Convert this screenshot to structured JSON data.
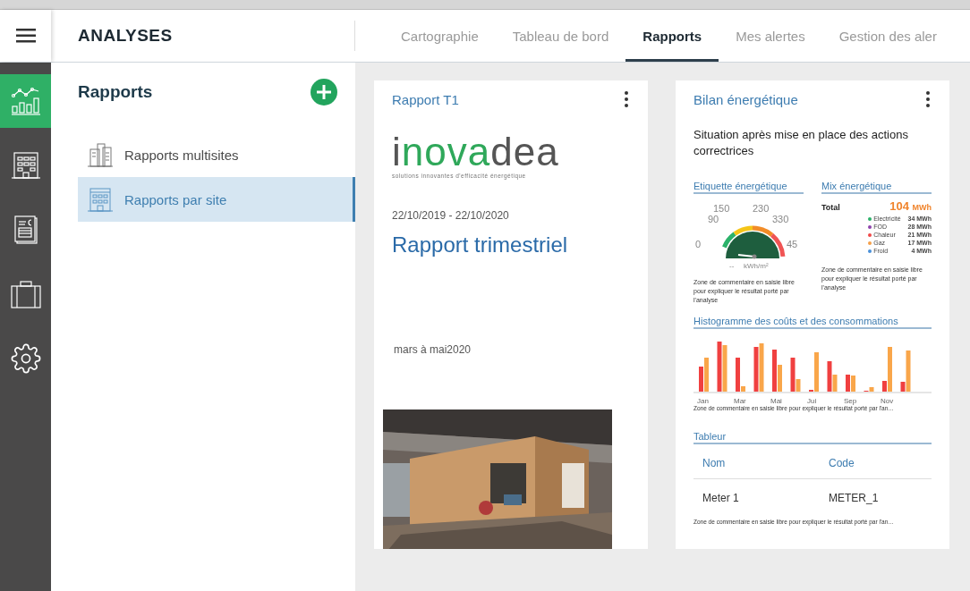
{
  "rail": {
    "items": [
      {
        "selected": true
      },
      {
        "selected": false
      },
      {
        "selected": false
      },
      {
        "selected": false
      },
      {
        "selected": false
      }
    ]
  },
  "header": {
    "title": "ANALYSES",
    "tabs": [
      {
        "label": "Cartographie",
        "selected": false
      },
      {
        "label": "Tableau de bord",
        "selected": false
      },
      {
        "label": "Rapports",
        "selected": true
      },
      {
        "label": "Mes alertes",
        "selected": false
      },
      {
        "label": "Gestion des aler",
        "selected": false
      }
    ]
  },
  "sidebar": {
    "title": "Rapports",
    "items": [
      {
        "label": "Rapports multisites",
        "selected": false
      },
      {
        "label": "Rapports par site",
        "selected": true
      }
    ]
  },
  "cards": [
    {
      "kind": "cover",
      "title": "Rapport T1",
      "logo": {
        "segments": [
          {
            "text": "i",
            "accent": false
          },
          {
            "text": "nova",
            "accent": true
          },
          {
            "text": "dea",
            "accent": false
          }
        ],
        "tagline": "solutions innovantes d'efficacité énergétique"
      },
      "dates": "22/10/2019 - 22/10/2020",
      "heading": "Rapport trimestriel",
      "period": "mars à mai2020"
    },
    {
      "kind": "summary",
      "title": "Bilan énergétique",
      "intro": "Situation après mise en place des actions correctrices",
      "label_section": {
        "title": "Etiquette énergétique",
        "scale": [
          "0",
          "90",
          "150",
          "230",
          "330",
          "45"
        ],
        "value": "--",
        "unit": "kWh/m²",
        "comment": "Zone de commentaire en saisie libre pour expliquer le résultat porté par l'analyse"
      },
      "mix_section": {
        "title": "Mix énergétique",
        "total_label": "Total",
        "total_value": "104",
        "total_unit": "MWh",
        "legend": [
          {
            "name": "Electricité",
            "value": "34 MWh",
            "color": "#2bb26a"
          },
          {
            "name": "FOD",
            "value": "28 MWh",
            "color": "#8e44ad"
          },
          {
            "name": "Chaleur",
            "value": "21 MWh",
            "color": "#f04848"
          },
          {
            "name": "Gaz",
            "value": "17 MWh",
            "color": "#f5a04a"
          },
          {
            "name": "Froid",
            "value": "4 MWh",
            "color": "#4a90d9"
          }
        ],
        "comment": "Zone de commentaire en saisie libre pour expliquer le résultat porté par l'analyse"
      },
      "histogram": {
        "title": "Histogramme des coûts et des consommations",
        "months": [
          "Jan",
          "Mar",
          "Mai",
          "Jui",
          "Sep",
          "Nov"
        ],
        "comment": "Zone de commentaire en saisie libre pour expliquer le résultat porté par l'an…"
      },
      "table": {
        "title": "Tableur",
        "columns": [
          "Nom",
          "Code"
        ],
        "rows": [
          [
            "Meter 1",
            "METER_1"
          ]
        ],
        "comment": "Zone de commentaire en saisie libre pour expliquer le résultat porté par l'an…"
      }
    }
  ]
}
